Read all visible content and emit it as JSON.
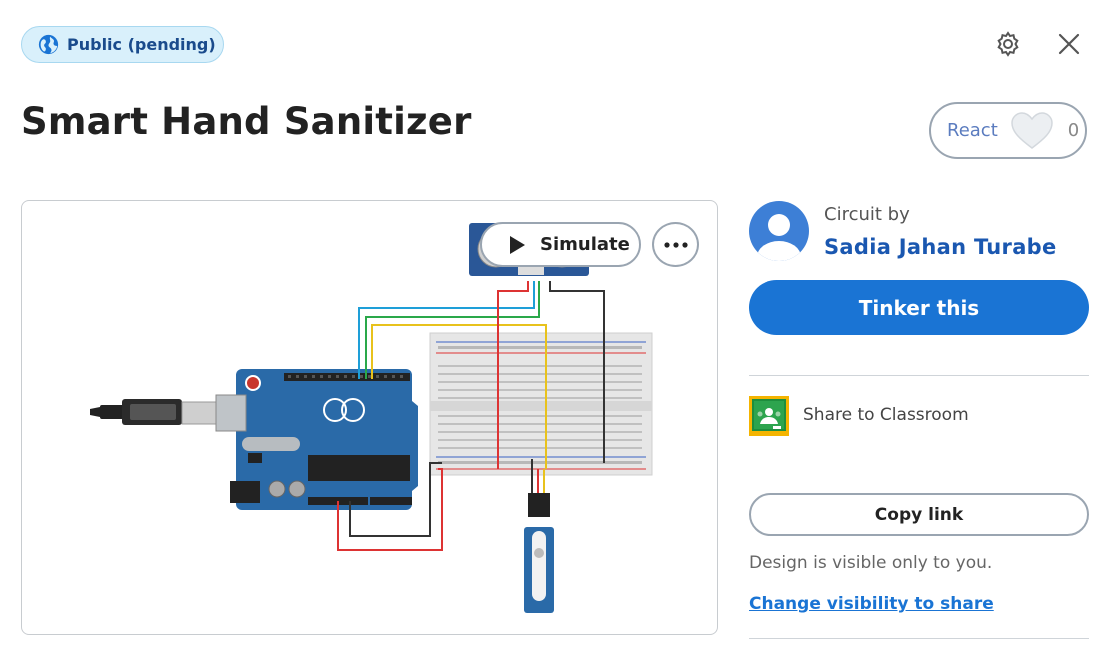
{
  "visibility_badge": {
    "label": "Public (pending)",
    "icon": "globe-icon"
  },
  "toolbar": {
    "settings_icon": "gear-icon",
    "close_icon": "close-icon"
  },
  "project": {
    "title": "Smart Hand Sanitizer"
  },
  "react": {
    "label": "React",
    "count": "0",
    "icon": "heart-icon"
  },
  "viewer": {
    "simulate_label": "Simulate",
    "more_icon": "more-options-icon"
  },
  "author": {
    "prefix": "Circuit by",
    "name": "Sadia Jahan Turabe"
  },
  "actions": {
    "tinker_label": "Tinker this",
    "classroom_label": "Share to Classroom",
    "copy_link_label": "Copy link",
    "visibility_note": "Design is visible only to you.",
    "change_visibility_label": "Change visibility to share"
  },
  "colors": {
    "primary": "#1a74d4",
    "author_link": "#1a57b0",
    "badge_bg": "#d9f0fb",
    "arduino_blue": "#2a6aa8",
    "classroom_green": "#1e8e3e",
    "classroom_yellow": "#f4b400"
  }
}
